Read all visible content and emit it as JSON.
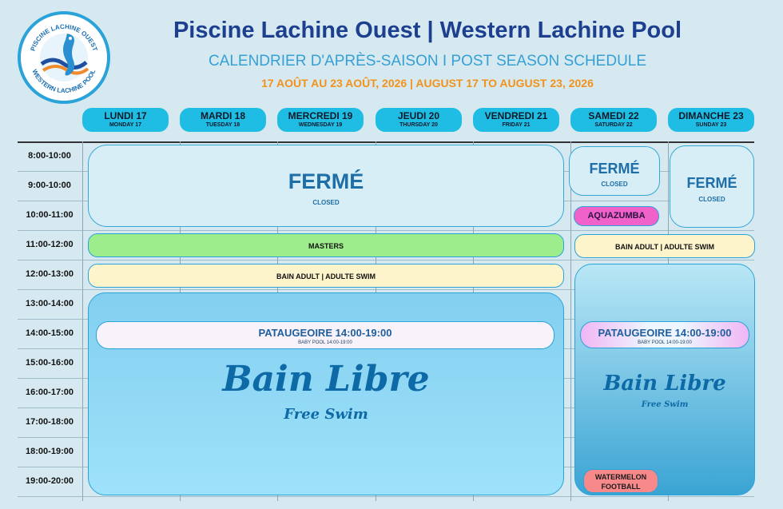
{
  "header": {
    "title": "Piscine Lachine Ouest | Western Lachine Pool",
    "subtitle": "CALENDRIER D'APRÈS-SAISON I POST SEASON SCHEDULE",
    "dates": "17 AOÛT AU 23 AOÛT, 2026 | AUGUST 17 TO AUGUST 23, 2026"
  },
  "logo": {
    "top_text": "PISCINE LACHINE OUEST",
    "bottom_text": "WESTERN LACHINE POOL",
    "icon": "seahorse-icon"
  },
  "days": [
    {
      "fr": "LUNDI 17",
      "en": "MONDAY 17"
    },
    {
      "fr": "MARDI 18",
      "en": "TUESDAY 18"
    },
    {
      "fr": "MERCREDI 19",
      "en": "WEDNESDAY 19"
    },
    {
      "fr": "JEUDI 20",
      "en": "THURSDAY 20"
    },
    {
      "fr": "VENDREDI 21",
      "en": "FRIDAY 21"
    },
    {
      "fr": "SAMEDI 22",
      "en": "SATURDAY 22"
    },
    {
      "fr": "DIMANCHE 23",
      "en": "SUNDAY 23"
    }
  ],
  "times": [
    "8:00-10:00",
    "9:00-10:00",
    "10:00-11:00",
    "11:00-12:00",
    "12:00-13:00",
    "13:00-14:00",
    "14:00-15:00",
    "15:00-16:00",
    "16:00-17:00",
    "17:00-18:00",
    "18:00-19:00",
    "19:00-20:00"
  ],
  "blocks": {
    "closed_week": {
      "big": "FERMÉ",
      "small": "CLOSED"
    },
    "closed_sat": {
      "big": "FERMÉ",
      "small": "CLOSED"
    },
    "closed_sun": {
      "big": "FERMÉ",
      "small": "CLOSED"
    },
    "aquazumba": "AQUAZUMBA",
    "masters": "MASTERS",
    "adult_sat": "BAIN ADULT | ADULTE SWIM",
    "adult_week": "BAIN ADULT | ADULTE SWIM",
    "baby_week": {
      "title": "PATAUGEOIRE 14:00-19:00",
      "sub": "BABY POOL 14:00-19:00"
    },
    "baby_sat": {
      "title": "PATAUGEOIRE 14:00-19:00",
      "sub": "BABY POOL 14:00-19:00"
    },
    "swim_week": {
      "big": "Bain Libre",
      "small": "Free Swim"
    },
    "swim_weekend": {
      "big": "Bain Libre",
      "small": "Free Swim"
    },
    "watermelon": "WATERMELON FOOTBALL"
  },
  "colors": {
    "accent": "#1fbde3",
    "title": "#1d3f8f",
    "dates": "#f2921c"
  }
}
